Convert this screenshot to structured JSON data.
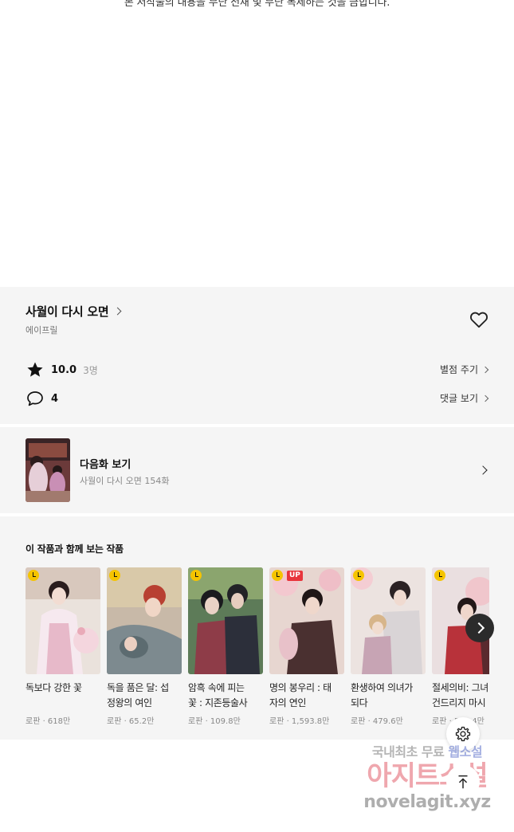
{
  "notice": "본 저작물의 내용을 무단 전재 및 무단 복제하는 것을 금합니다.",
  "work": {
    "title": "사월이 다시 오면",
    "author": "에이프릴",
    "rating": "10.0",
    "rating_count": "3명",
    "rate_link": "별점 주기",
    "comment_count": "4",
    "comment_link": "댓글 보기"
  },
  "next_episode": {
    "label": "다음화 보기",
    "subtitle": "사월이 다시 오면 154화"
  },
  "recommend": {
    "heading": "이 작품과 함께 보는 작품",
    "items": [
      {
        "title": "독보다 강한 꽃",
        "meta": "로판 · 618만",
        "badge": ""
      },
      {
        "title": "독을 품은 달: 섭\n정왕의 여인",
        "meta": "로판 · 65.2만",
        "badge": ""
      },
      {
        "title": "암흑 속에 피는\n꽃 : 지존등술사",
        "meta": "로판 · 109.8만",
        "badge": ""
      },
      {
        "title": "명의 봉우리 : 태\n자의 연인",
        "meta": "로판 · 1,593.8만",
        "badge": "UP"
      },
      {
        "title": "환생하여 의녀가\n되다",
        "meta": "로판 · 479.6만",
        "badge": ""
      },
      {
        "title": "절세의비: 그녀\n건드리지 마시",
        "meta": "로판 · 503.4만",
        "badge": ""
      }
    ]
  },
  "watermark": {
    "line1_a": "국내최초 무료 ",
    "line1_b": "웹소설",
    "line2": "아지트소설",
    "line3": "novelagit.xyz"
  },
  "colors": {
    "section_bg": "#f5f5f5",
    "badge_yellow": "#f5c400",
    "badge_up": "#e8353c"
  }
}
